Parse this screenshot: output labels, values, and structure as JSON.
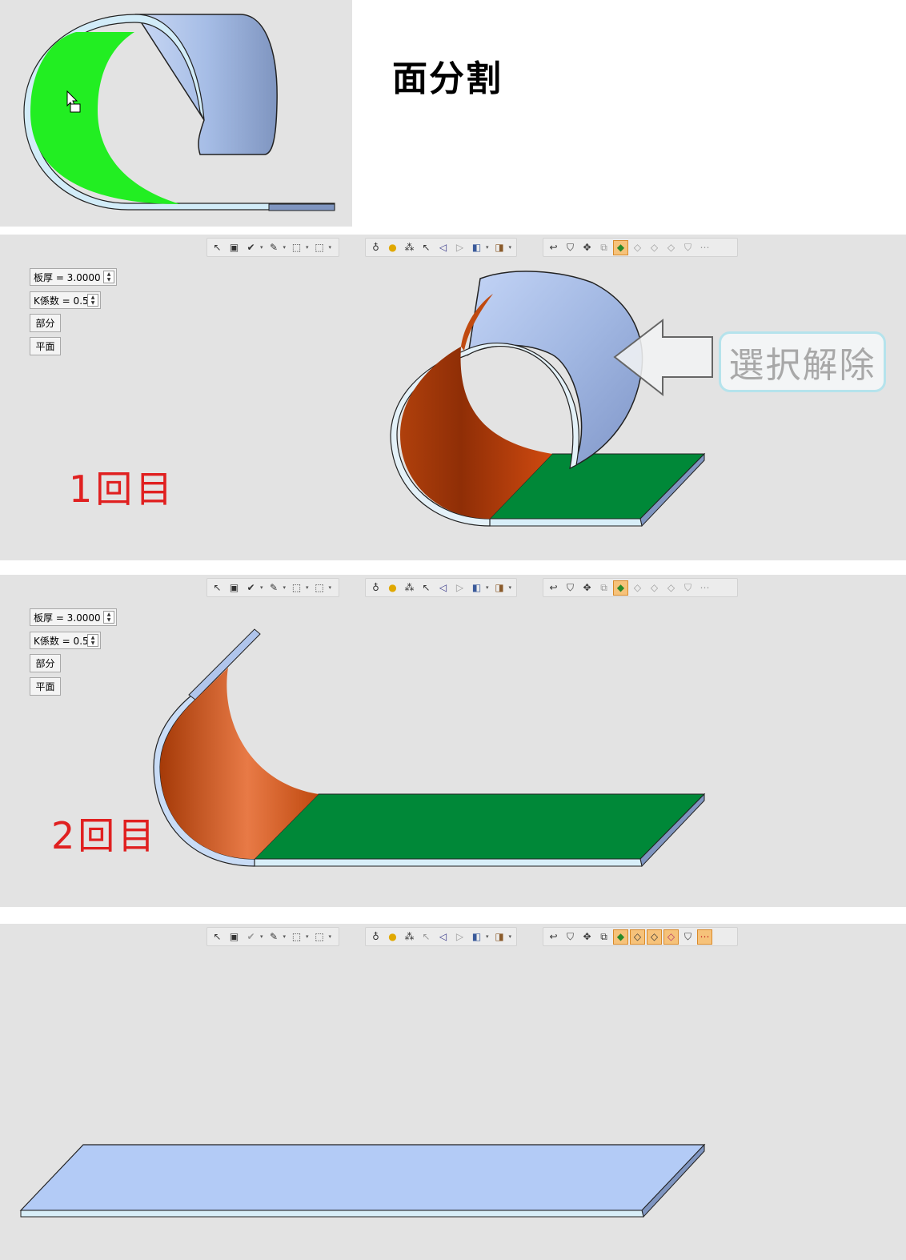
{
  "title": "面分割",
  "callout": "選択解除",
  "params": {
    "thickness_label": "板厚 =  3.0000",
    "kfactor_label": "K係数 = 0.5",
    "partial_button": "部分",
    "flat_button": "平面"
  },
  "steps": [
    {
      "label": "1回目"
    },
    {
      "label": "2回目"
    }
  ],
  "toolbar": {
    "group1": [
      "select-clear-icon",
      "box-select-icon",
      "check-select-icon",
      "filter-select-icon",
      "rect-select-icon",
      "window-select-icon"
    ],
    "group2": [
      "light-off-icon",
      "light-on-icon",
      "light-group-icon",
      "pointer-light-icon",
      "arrow-left-icon",
      "arrow-right-icon",
      "cube-icon",
      "cube-view-icon"
    ],
    "group3": [
      "undo-icon",
      "filter-icon",
      "filter-pick-icon",
      "filter-merge-icon",
      "filter-face-icon",
      "filter-edge-icon",
      "filter-edge2-icon",
      "filter-edge3-icon",
      "filter-cut-icon",
      "filter-more-icon"
    ]
  },
  "colors": {
    "panel_bg": "#e3e3e3",
    "highlight_green": "#22ee22",
    "bend_orange": "#c04a10",
    "flat_green": "#008838",
    "sheet_blue": "#a9c0e8",
    "label_red": "#e02020"
  }
}
